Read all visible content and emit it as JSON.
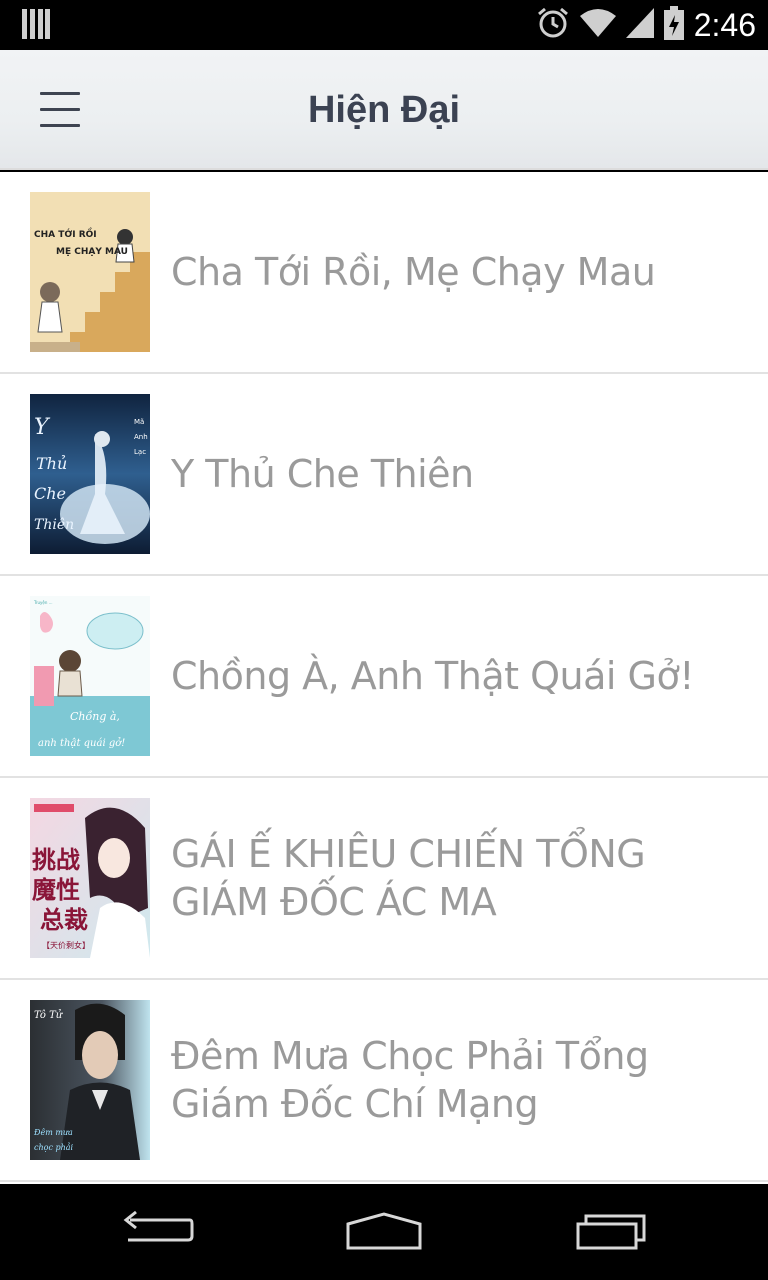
{
  "status_bar": {
    "time": "2:46",
    "icons": [
      "notification-bars-icon",
      "alarm-icon",
      "wifi-icon",
      "signal-icon",
      "battery-icon"
    ]
  },
  "app_bar": {
    "title": "Hiện Đại",
    "menu_icon": "hamburger-menu-icon"
  },
  "books": [
    {
      "title": "Cha Tới Rồi, Mẹ Chạy Mau",
      "cover_text": "CHA TỚI RỒI MẸ CHẠY MAU"
    },
    {
      "title": "Y Thủ Che Thiên",
      "cover_text": "Y Thủ Che Thiên",
      "cover_author": "Mã Anh Lạc"
    },
    {
      "title": "Chồng À, Anh Thật Quái Gở!",
      "cover_text": "Chồng à, anh thật quái gở!"
    },
    {
      "title": "GÁI Ế KHIÊU CHIẾN TỔNG GIÁM ĐỐC ÁC MA",
      "cover_text": "挑战魔性总裁"
    },
    {
      "title": "Đêm Mưa Chọc Phải Tổng Giám Đốc Chí Mạng",
      "cover_text": "Tô Tử"
    }
  ],
  "nav_bar": {
    "back_icon": "back-icon",
    "home_icon": "home-icon",
    "recents_icon": "recent-apps-icon"
  },
  "colors": {
    "app_bar_bg": "#eceff1",
    "title_text": "#3b4252",
    "row_text": "#9a9a9a",
    "divider": "#e2e2e2"
  }
}
